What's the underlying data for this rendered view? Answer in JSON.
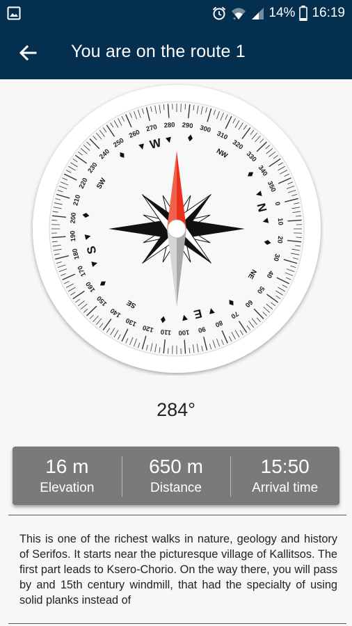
{
  "status_bar": {
    "battery": "14%",
    "time": "16:19",
    "icons": [
      "gallery-icon",
      "alarm-icon",
      "wifi-icon",
      "signal-icon",
      "battery-icon"
    ]
  },
  "app_bar": {
    "title": "You are on the route 1",
    "back_icon": "arrow-left-icon"
  },
  "compass": {
    "heading": "284°",
    "direction_labels": [
      "N",
      "E",
      "S",
      "W"
    ],
    "intercardinal_labels": [
      "NE",
      "SE",
      "SW",
      "NW"
    ],
    "degree_labels": [
      "0",
      "10",
      "20",
      "30",
      "40",
      "50",
      "60",
      "70",
      "80",
      "90",
      "100",
      "110",
      "120",
      "130",
      "140",
      "150",
      "160",
      "170",
      "180",
      "190",
      "200",
      "210",
      "220",
      "230",
      "240",
      "250",
      "260",
      "270",
      "280",
      "290",
      "300",
      "310",
      "320",
      "330",
      "340",
      "350"
    ],
    "needle_color": "#e8301c",
    "needle_color_light": "#f0634a"
  },
  "stats": [
    {
      "value": "16 m",
      "label": "Elevation"
    },
    {
      "value": "650 m",
      "label": "Distance"
    },
    {
      "value": "15:50",
      "label": "Arrival time"
    }
  ],
  "description": "This is one of the richest walks in nature, geology and history of Serifos. It starts near the picturesque village of Kallitsos. The first part leads to Ksero-Chorio. On the way there, you will pass by and 15th century windmill, that had the specialty of using solid planks instead of"
}
